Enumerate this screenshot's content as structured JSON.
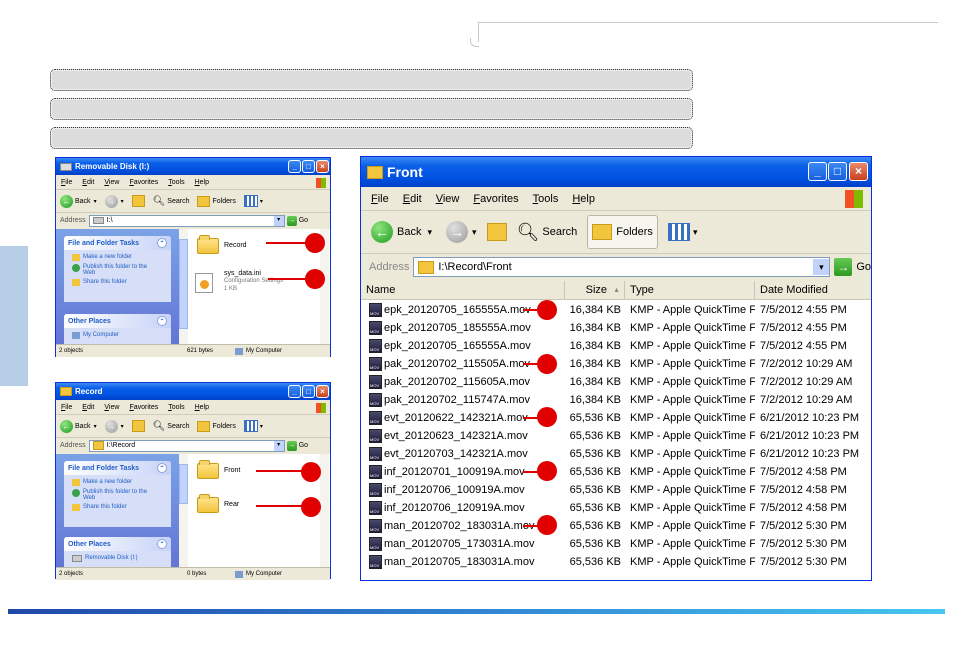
{
  "banners": [
    "",
    "",
    ""
  ],
  "win_removable": {
    "title": "Removable Disk (I:)",
    "menu": [
      "File",
      "Edit",
      "View",
      "Favorites",
      "Tools",
      "Help"
    ],
    "toolbar": {
      "back": "Back",
      "search": "Search",
      "folders": "Folders"
    },
    "address_label": "Address",
    "address": "I:\\",
    "go": "Go",
    "task_header": "File and Folder Tasks",
    "tasks": [
      "Make a new folder",
      "Publish this folder to the Web",
      "Share this folder"
    ],
    "places_header": "Other Places",
    "places": [
      "My Computer"
    ],
    "items": [
      {
        "name": "Record"
      },
      {
        "name": "sys_data.ini",
        "desc": "Configuration Settings",
        "size": "1 KB"
      }
    ],
    "status": {
      "objects": "2 objects",
      "size": "621 bytes",
      "location": "My Computer"
    }
  },
  "win_record": {
    "title": "Record",
    "menu": [
      "File",
      "Edit",
      "View",
      "Favorites",
      "Tools",
      "Help"
    ],
    "toolbar": {
      "back": "Back",
      "search": "Search",
      "folders": "Folders"
    },
    "address_label": "Address",
    "address": "I:\\Record",
    "go": "Go",
    "task_header": "File and Folder Tasks",
    "tasks": [
      "Make a new folder",
      "Publish this folder to the Web",
      "Share this folder"
    ],
    "places_header": "Other Places",
    "places": [
      "Removable Disk (I:)"
    ],
    "items": [
      {
        "name": "Front"
      },
      {
        "name": "Rear"
      }
    ],
    "status": {
      "objects": "2 objects",
      "size": "0 bytes",
      "location": "My Computer"
    }
  },
  "win_front": {
    "title": "Front",
    "menu": [
      "File",
      "Edit",
      "View",
      "Favorites",
      "Tools",
      "Help"
    ],
    "toolbar": {
      "back": "Back",
      "search": "Search",
      "folders": "Folders"
    },
    "address_label": "Address",
    "address": "I:\\Record\\Front",
    "go": "Go",
    "columns": {
      "name": "Name",
      "size": "Size",
      "type": "Type",
      "date": "Date Modified"
    },
    "files": [
      {
        "name": "epk_20120705_165555A.mov",
        "size": "16,384 KB",
        "type": "KMP - Apple QuickTime File",
        "date": "7/5/2012 4:55 PM"
      },
      {
        "name": "epk_20120705_185555A.mov",
        "size": "16,384 KB",
        "type": "KMP - Apple QuickTime File",
        "date": "7/5/2012 4:55 PM"
      },
      {
        "name": "epk_20120705_165555A.mov",
        "size": "16,384 KB",
        "type": "KMP - Apple QuickTime File",
        "date": "7/5/2012 4:55 PM"
      },
      {
        "name": "pak_20120702_115505A.mov",
        "size": "16,384 KB",
        "type": "KMP - Apple QuickTime File",
        "date": "7/2/2012 10:29 AM"
      },
      {
        "name": "pak_20120702_115605A.mov",
        "size": "16,384 KB",
        "type": "KMP - Apple QuickTime File",
        "date": "7/2/2012 10:29 AM"
      },
      {
        "name": "pak_20120702_115747A.mov",
        "size": "16,384 KB",
        "type": "KMP - Apple QuickTime File",
        "date": "7/2/2012 10:29 AM"
      },
      {
        "name": "evt_20120622_142321A.mov",
        "size": "65,536 KB",
        "type": "KMP - Apple QuickTime File",
        "date": "6/21/2012 10:23 PM"
      },
      {
        "name": "evt_20120623_142321A.mov",
        "size": "65,536 KB",
        "type": "KMP - Apple QuickTime File",
        "date": "6/21/2012 10:23 PM"
      },
      {
        "name": "evt_20120703_142321A.mov",
        "size": "65,536 KB",
        "type": "KMP - Apple QuickTime File",
        "date": "6/21/2012 10:23 PM"
      },
      {
        "name": "inf_20120701_100919A.mov",
        "size": "65,536 KB",
        "type": "KMP - Apple QuickTime File",
        "date": "7/5/2012 4:58 PM"
      },
      {
        "name": "inf_20120706_100919A.mov",
        "size": "65,536 KB",
        "type": "KMP - Apple QuickTime File",
        "date": "7/5/2012 4:58 PM"
      },
      {
        "name": "inf_20120706_120919A.mov",
        "size": "65,536 KB",
        "type": "KMP - Apple QuickTime File",
        "date": "7/5/2012 4:58 PM"
      },
      {
        "name": "man_20120702_183031A.mov",
        "size": "65,536 KB",
        "type": "KMP - Apple QuickTime File",
        "date": "7/5/2012 5:30 PM"
      },
      {
        "name": "man_20120705_173031A.mov",
        "size": "65,536 KB",
        "type": "KMP - Apple QuickTime File",
        "date": "7/5/2012 5:30 PM"
      },
      {
        "name": "man_20120705_183031A.mov",
        "size": "65,536 KB",
        "type": "KMP - Apple QuickTime File",
        "date": "7/5/2012 5:30 PM"
      }
    ]
  },
  "colors": {
    "accent": "#e00000",
    "title_bar": "#0052e0",
    "task_link": "#215dc6"
  },
  "icons": [
    "folder-icon",
    "mov-file-icon",
    "ini-file-icon",
    "back-arrow-icon",
    "forward-arrow-icon",
    "search-icon",
    "folders-icon",
    "views-icon",
    "go-arrow-icon",
    "windows-logo-icon"
  ]
}
